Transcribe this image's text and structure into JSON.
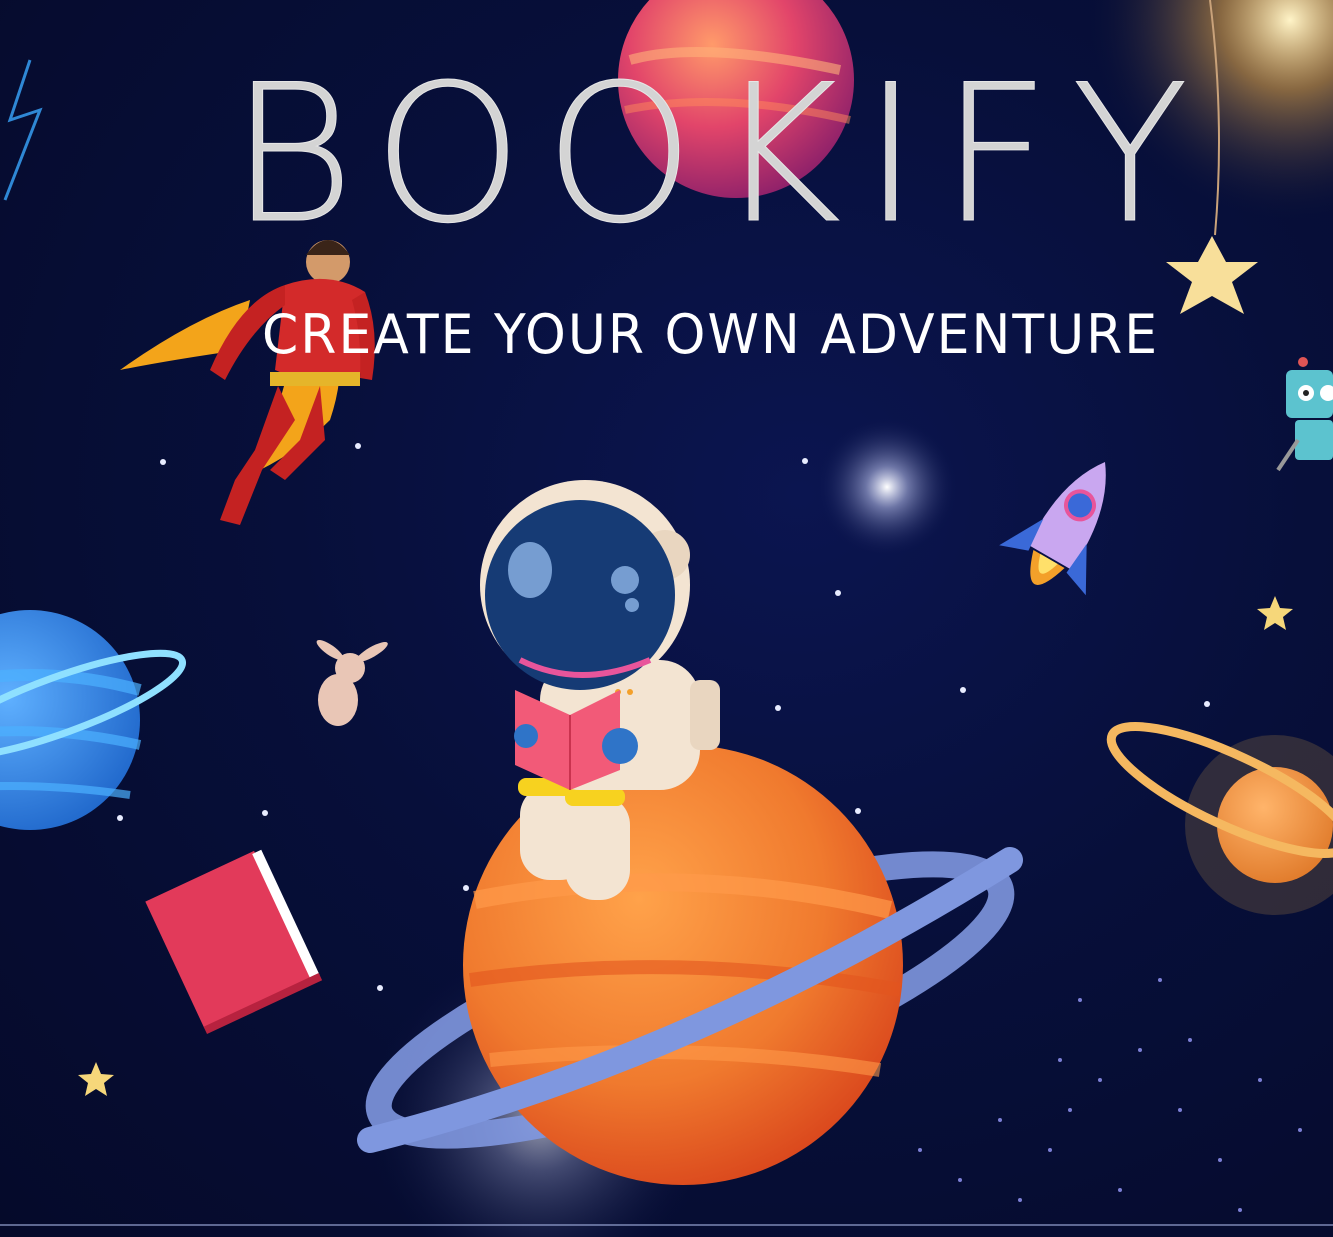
{
  "title": "BOOKIFY",
  "tagline": "CREATE YOUR OWN ADVENTURE",
  "colors": {
    "background": "#070f3a",
    "title": "#d4d4d4",
    "tagline": "#ffffff",
    "orange_planet": "#f07a2e",
    "ring": "#7f97df",
    "book": "#e23a5a",
    "star": "#f6d77a"
  },
  "icons": [
    "planet-pink-icon",
    "superhero-icon",
    "astronaut-icon",
    "rocket-icon",
    "robot-icon",
    "blue-planet-icon",
    "orange-planet-icon",
    "ringed-planet-icon",
    "red-book-icon",
    "bunny-icon",
    "hanging-star-icon",
    "star-icon",
    "galaxy-dust-icon"
  ]
}
